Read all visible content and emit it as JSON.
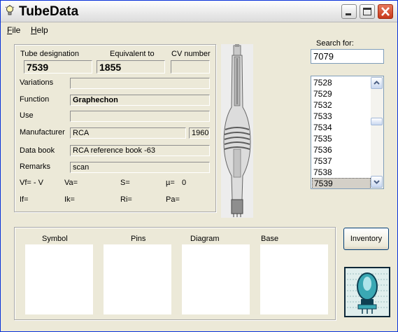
{
  "window": {
    "title": "TubeData"
  },
  "menu": [
    {
      "label": "File",
      "ul": "F",
      "rest": "ile"
    },
    {
      "label": "Help",
      "ul": "H",
      "rest": "elp"
    }
  ],
  "labels": {
    "tube_designation": "Tube designation",
    "equivalent_to": "Equivalent to",
    "cv_number": "CV number",
    "variations": "Variations",
    "function": "Function",
    "use": "Use",
    "manufacturer": "Manufacturer",
    "data_book": "Data book",
    "remarks": "Remarks",
    "search_for": "Search for:"
  },
  "fields": {
    "tube_designation": "7539",
    "equivalent_to": "1855",
    "cv_number": "",
    "variations": "",
    "function": "Graphechon",
    "use": "",
    "manufacturer": "RCA",
    "year": "1960",
    "data_book": "RCA reference book -63",
    "remarks": "scan"
  },
  "params": {
    "vf": "Vf= - V",
    "va": "Va=",
    "s": "S=",
    "mu": "µ=",
    "mu_value": "0",
    "if": "If=",
    "ik": "Ik=",
    "ri": "Ri=",
    "pa": "Pa="
  },
  "search": {
    "value": "7079"
  },
  "tube_list": [
    "7528",
    "7529",
    "7532",
    "7533",
    "7534",
    "7535",
    "7536",
    "7537",
    "7538",
    "7539"
  ],
  "tube_list_selected_index": 9,
  "panels": {
    "symbol": "Symbol",
    "pins": "Pins",
    "diagram": "Diagram",
    "base": "Base"
  },
  "buttons": {
    "inventory": "Inventory"
  },
  "colors": {
    "title_bar": "#e9e9e9",
    "close_button": "#c7381a",
    "window_bg": "#ece9d8",
    "selection": "#d4d0c8"
  }
}
